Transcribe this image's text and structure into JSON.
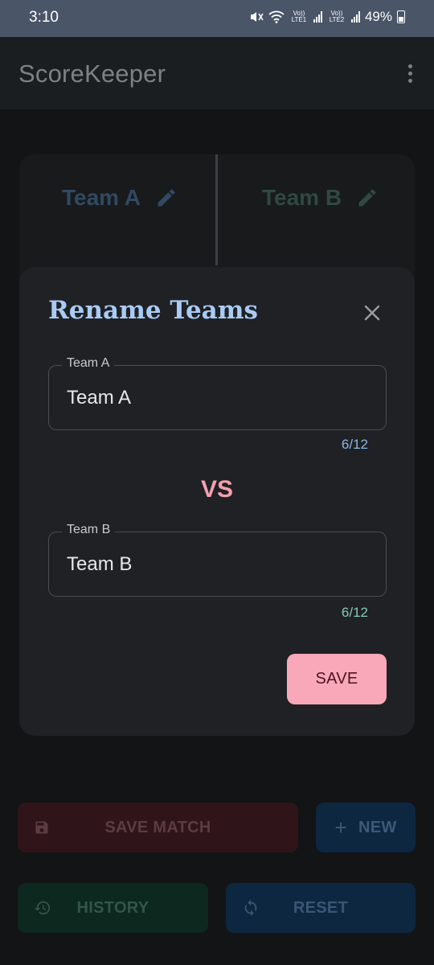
{
  "status_bar": {
    "time": "3:10",
    "sim1_label": "Vo)) LTE1",
    "sim2_label": "Vo)) LTE2",
    "battery": "49%"
  },
  "app_bar": {
    "title": "ScoreKeeper"
  },
  "scoreboard": {
    "team_a_name": "Team A",
    "team_b_name": "Team B"
  },
  "dialog": {
    "title": "Rename Teams",
    "team_a_label": "Team A",
    "team_a_value": "Team A",
    "team_a_counter": "6/12",
    "vs_label": "VS",
    "team_b_label": "Team B",
    "team_b_value": "Team B",
    "team_b_counter": "6/12",
    "save_label": "SAVE"
  },
  "actions": {
    "save_match_label": "SAVE MATCH",
    "new_label": "NEW",
    "history_label": "HISTORY",
    "reset_label": "RESET"
  },
  "colors": {
    "dialog_title": "#a9cbf5",
    "vs": "#f4a0ae",
    "save_button": "#f8a8b8",
    "status_bar": "#4a5568"
  },
  "icons": {
    "edit": "pencil-icon",
    "close": "close-icon",
    "save_match": "floppy-disk-icon",
    "new": "plus-icon",
    "history": "history-icon",
    "reset": "sync-icon"
  }
}
